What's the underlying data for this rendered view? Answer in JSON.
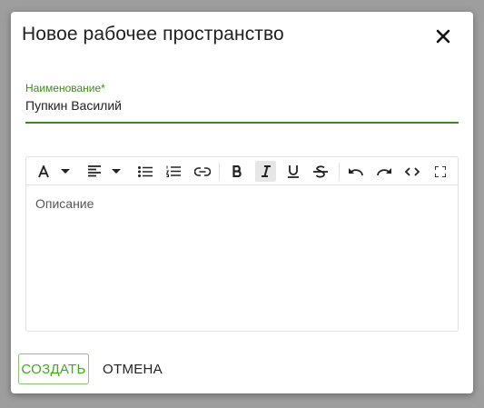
{
  "dialog": {
    "title": "Новое рабочее пространство",
    "close_icon": "close-icon"
  },
  "name_field": {
    "label": "Наименование*",
    "value": "Пупкин Василий"
  },
  "editor": {
    "placeholder": "Описание",
    "toolbar": [
      "font-color-icon",
      "dropdown-caret-icon",
      "align-left-icon",
      "dropdown-caret-icon",
      "bulleted-list-icon",
      "numbered-list-icon",
      "link-icon",
      "bold-icon",
      "italic-icon",
      "underline-icon",
      "strikethrough-icon",
      "undo-icon",
      "redo-icon",
      "code-icon",
      "fullscreen-icon"
    ],
    "active_tool": "italic-icon"
  },
  "buttons": {
    "create": "СОЗДАТЬ",
    "cancel": "ОТМЕНА"
  },
  "colors": {
    "accent": "#3c8a1e",
    "create_text": "#3cae12",
    "overlay": "#9e9e9e"
  }
}
